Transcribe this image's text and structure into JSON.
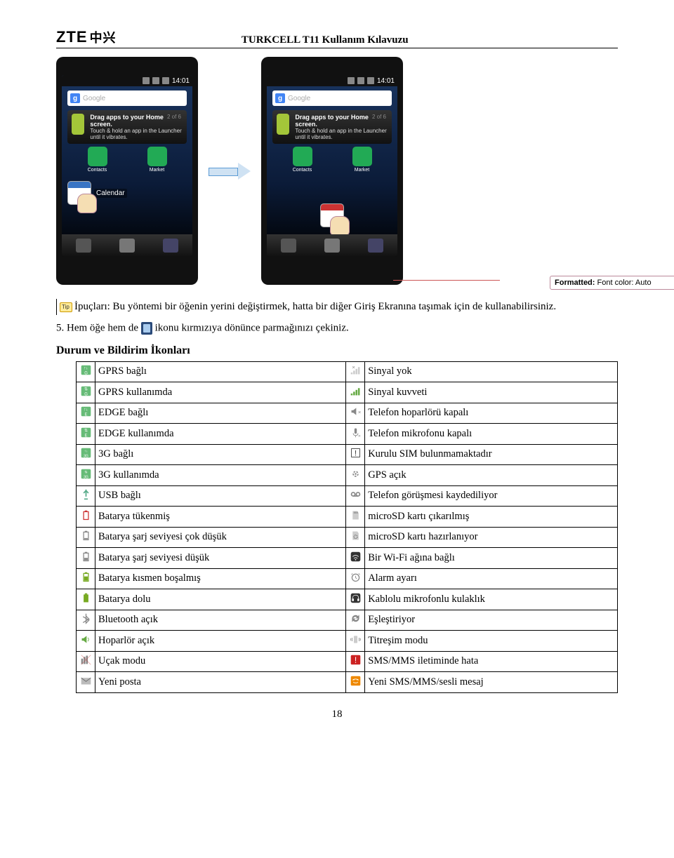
{
  "header": {
    "title": "TURKCELL T11 Kullanım Kılavuzu",
    "logo": "ZTE",
    "logo_sub": "中兴"
  },
  "phone": {
    "time": "14:01",
    "search_placeholder": "Google",
    "tip_title": "Drag apps to your Home screen.",
    "tip_body": "Touch & hold an app in the Launcher until it vibrates.",
    "tip_count": "2 of 6",
    "app_contacts": "Contacts",
    "app_market": "Market",
    "calendar_label": "Calendar"
  },
  "comment": {
    "label": "Formatted:",
    "text": "Font color: Auto"
  },
  "tip_para": "İpuçları: Bu yöntemi bir öğenin yerini değiştirmek, hatta bir diğer Giriş Ekranına taşımak için de kullanabilirsiniz.",
  "step5_prefix": "5.   Hem öğe hem de ",
  "step5_suffix": " ikonu kırmızıya dönünce parmağınızı çekiniz.",
  "section_title": "Durum ve Bildirim İkonları",
  "table": [
    {
      "l": "GPRS bağlı",
      "r": "Sinyal yok"
    },
    {
      "l": "GPRS kullanımda",
      "r": "Sinyal kuvveti"
    },
    {
      "l": "EDGE bağlı",
      "r": "Telefon hoparlörü kapalı"
    },
    {
      "l": "EDGE kullanımda",
      "r": "Telefon mikrofonu kapalı"
    },
    {
      "l": "3G bağlı",
      "r": "Kurulu SIM bulunmamaktadır"
    },
    {
      "l": "3G kullanımda",
      "r": "GPS açık"
    },
    {
      "l": "USB bağlı",
      "r": "Telefon görüşmesi kaydediliyor"
    },
    {
      "l": "Batarya tükenmiş",
      "r": "microSD kartı çıkarılmış"
    },
    {
      "l": "Batarya şarj seviyesi çok düşük",
      "r": "microSD kartı hazırlanıyor"
    },
    {
      "l": "Batarya şarj seviyesi düşük",
      "r": "Bir Wi-Fi ağına bağlı"
    },
    {
      "l": "Batarya kısmen boşalmış",
      "r": "Alarm ayarı"
    },
    {
      "l": "Batarya dolu",
      "r": "Kablolu mikrofonlu kulaklık"
    },
    {
      "l": "Bluetooth açık",
      "r": "Eşleştiriyor"
    },
    {
      "l": "Hoparlör açık",
      "r": "Titreşim modu"
    },
    {
      "l": "Uçak modu",
      "r": "SMS/MMS iletiminde hata"
    },
    {
      "l": "Yeni posta",
      "r": "Yeni SMS/MMS/sesli mesaj"
    }
  ],
  "icons_left": [
    "gprs-up",
    "gprs-both",
    "edge-up",
    "edge-both",
    "3g-up",
    "3g-both",
    "usb",
    "batt-empty",
    "batt-vlow",
    "batt-low",
    "batt-partial",
    "batt-full",
    "bluetooth",
    "speaker",
    "airplane",
    "mail"
  ],
  "icons_right": [
    "signal-none",
    "signal-full",
    "speaker-off",
    "mic-off",
    "sim-warn",
    "gps",
    "voicemail",
    "sd-out",
    "sd-prep",
    "wifi",
    "alarm",
    "headset",
    "sync",
    "vibrate",
    "sms-error",
    "sms-new"
  ],
  "page_number": "18"
}
